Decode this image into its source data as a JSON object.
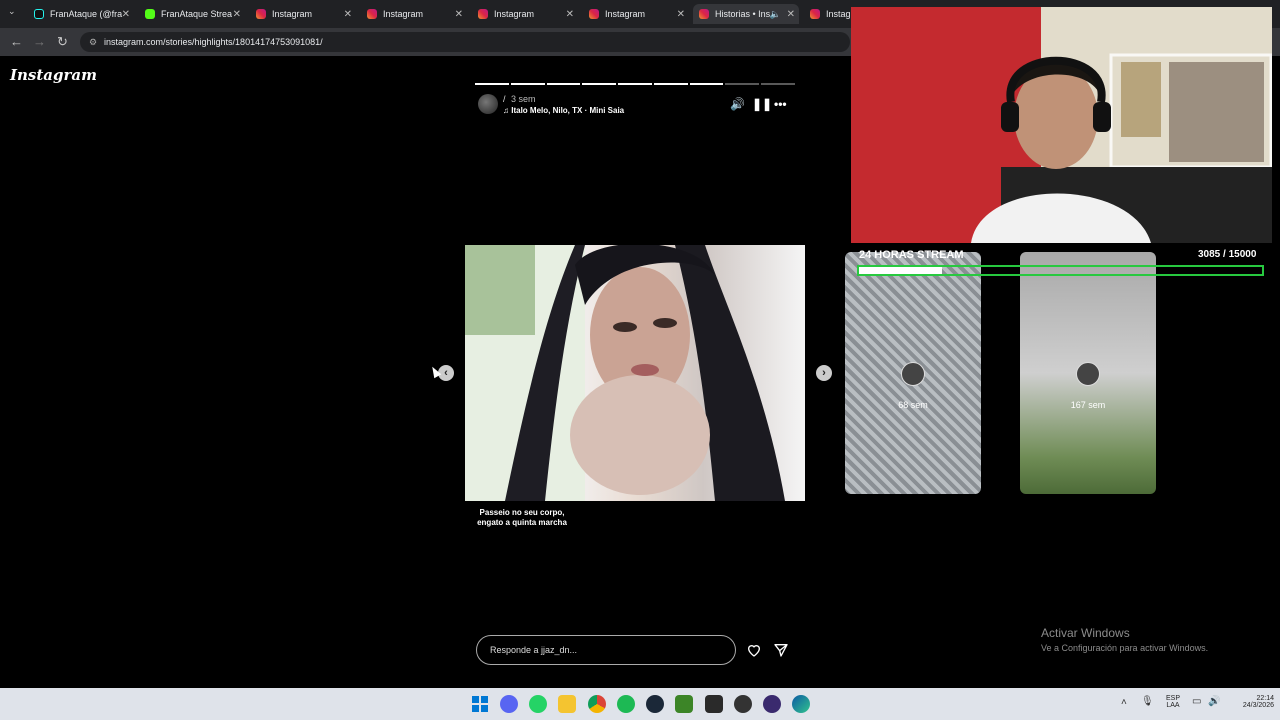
{
  "browser": {
    "tabs": [
      {
        "title": "FranAtaque (@fra",
        "icon": "tiktok-icon"
      },
      {
        "title": "FranAtaque Strea",
        "icon": "kick-icon"
      },
      {
        "title": "Instagram",
        "icon": "instagram-icon"
      },
      {
        "title": "Instagram",
        "icon": "instagram-icon"
      },
      {
        "title": "Instagram",
        "icon": "instagram-icon"
      },
      {
        "title": "Instagram",
        "icon": "instagram-icon"
      },
      {
        "title": "Historias • Ins",
        "icon": "instagram-icon",
        "active": true
      },
      {
        "title": "Instagra",
        "icon": "instagram-icon"
      }
    ],
    "url": "instagram.com/stories/highlights/18014174753091081/"
  },
  "instagram": {
    "logo": "Instagram",
    "story": {
      "username": "/",
      "time": "3 sem",
      "music": "Italo Melo, Nilo, TX · Mini Saia",
      "caption": "Passeio no seu corpo, engato a quinta marcha",
      "reply_placeholder": "Responde a jjaz_dn...",
      "progress": {
        "segments": 9,
        "completed": 7
      }
    },
    "previews": [
      {
        "label": "68 sem"
      },
      {
        "label": "167 sem"
      }
    ]
  },
  "stream_overlay": {
    "goal_title": "24 HORAS STREAM",
    "goal_current": 3085,
    "goal_target": 15000,
    "goal_text": "3085  / 15000",
    "bar_color": "#27c93f"
  },
  "windows": {
    "activate_title": "Activar Windows",
    "activate_sub": "Ve a Configuración para activar Windows.",
    "lang_top": "ESP",
    "lang_bottom": "LAA",
    "time": "22:14",
    "date": "24/3/2026"
  }
}
